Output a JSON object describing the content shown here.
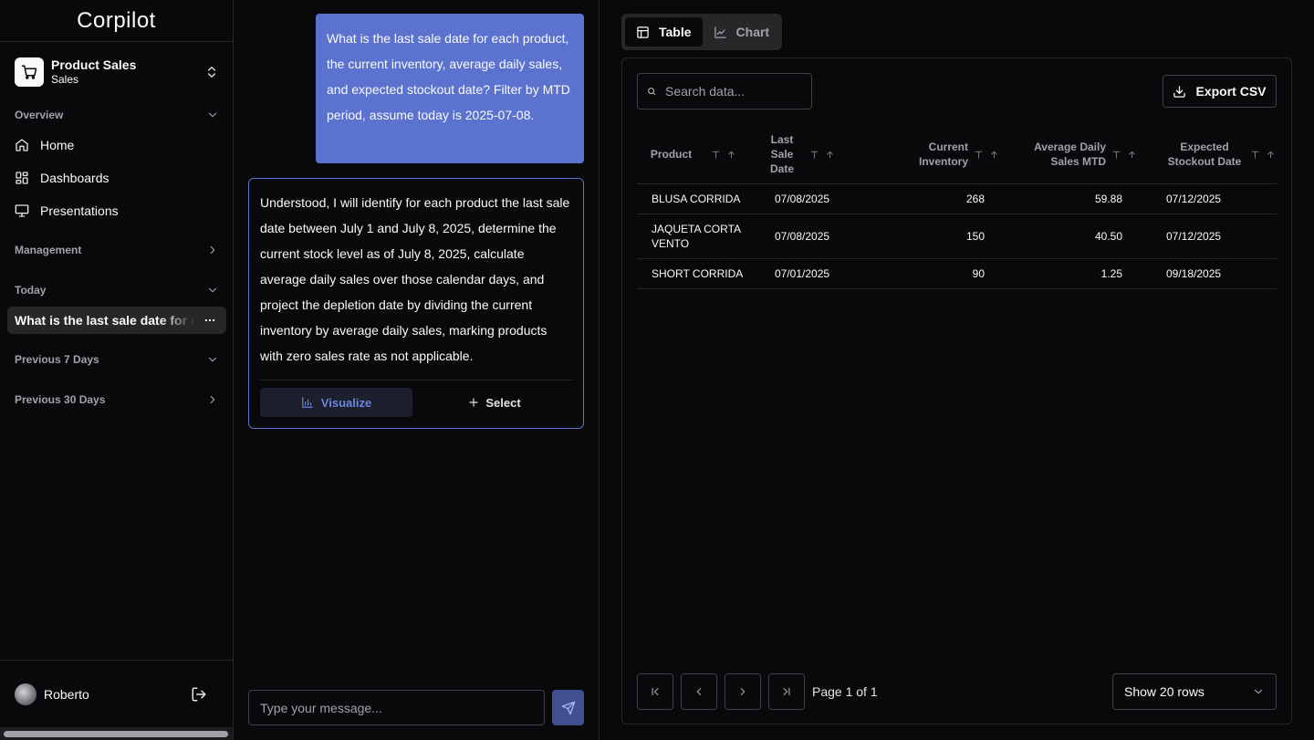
{
  "app": {
    "name": "Corpilot"
  },
  "workspace": {
    "title": "Product Sales",
    "subtitle": "Sales"
  },
  "sidebar": {
    "overview_label": "Overview",
    "nav": [
      {
        "label": "Home",
        "icon": "home-icon"
      },
      {
        "label": "Dashboards",
        "icon": "dashboard-icon"
      },
      {
        "label": "Presentations",
        "icon": "presentation-icon"
      }
    ],
    "management_label": "Management",
    "today_label": "Today",
    "active_chat": "What is the last sale date for each product",
    "prev7_label": "Previous 7 Days",
    "prev30_label": "Previous 30 Days"
  },
  "user": {
    "name": "Roberto"
  },
  "chat": {
    "user_message": "What is the last sale date for each product, the current inventory, average daily sales, and expected stockout date? Filter by MTD period, assume today is 2025-07-08.",
    "bot_message": "Understood, I will identify for each product the last sale date between July 1 and July 8, 2025, determine the current stock level as of July 8, 2025, calculate average daily sales over those calendar days, and project the depletion date by dividing the current inventory by average daily sales, marking products with zero sales rate as not applicable.",
    "visualize_label": "Visualize",
    "select_label": "Select",
    "composer_placeholder": "Type your message..."
  },
  "view_tabs": {
    "table": "Table",
    "chart": "Chart"
  },
  "table_panel": {
    "search_placeholder": "Search data...",
    "export_label": "Export CSV",
    "columns": [
      "Product",
      "Last Sale Date",
      "Current Inventory",
      "Average Daily Sales MTD",
      "Expected Stockout Date"
    ],
    "rows": [
      [
        "BLUSA CORRIDA",
        "07/08/2025",
        "268",
        "59.88",
        "07/12/2025"
      ],
      [
        "JAQUETA CORTA VENTO",
        "07/08/2025",
        "150",
        "40.50",
        "07/12/2025"
      ],
      [
        "SHORT CORRIDA",
        "07/01/2025",
        "90",
        "1.25",
        "09/18/2025"
      ]
    ],
    "page_info": "Page 1 of 1",
    "rows_per_page": "Show 20 rows"
  },
  "colors": {
    "accent": "#5b72cf",
    "background": "#09090b",
    "border": "#27272a"
  }
}
